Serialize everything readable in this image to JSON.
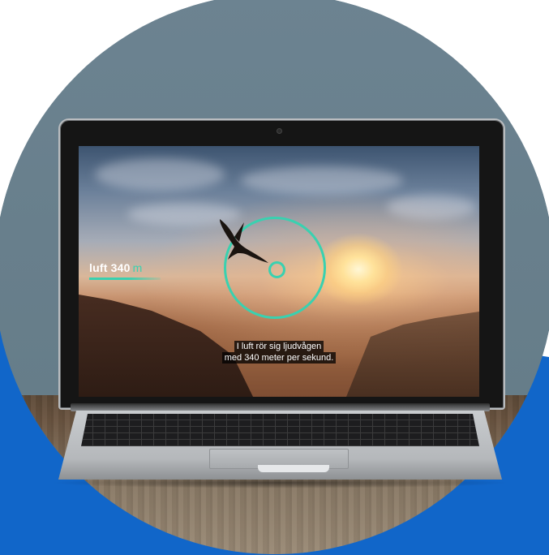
{
  "screen_overlay": {
    "medium_label": "luft 340",
    "medium_unit": "m",
    "caption_line1": "I luft rör sig ljudvågen",
    "caption_line2": "med 340 meter per sekund."
  },
  "colors": {
    "accent": "#39d1b0",
    "background_blue": "#1166c9",
    "wall": "#667f8c"
  },
  "icons": [
    "bird-silhouette-icon",
    "sound-ring-icon",
    "target-ring-icon"
  ]
}
